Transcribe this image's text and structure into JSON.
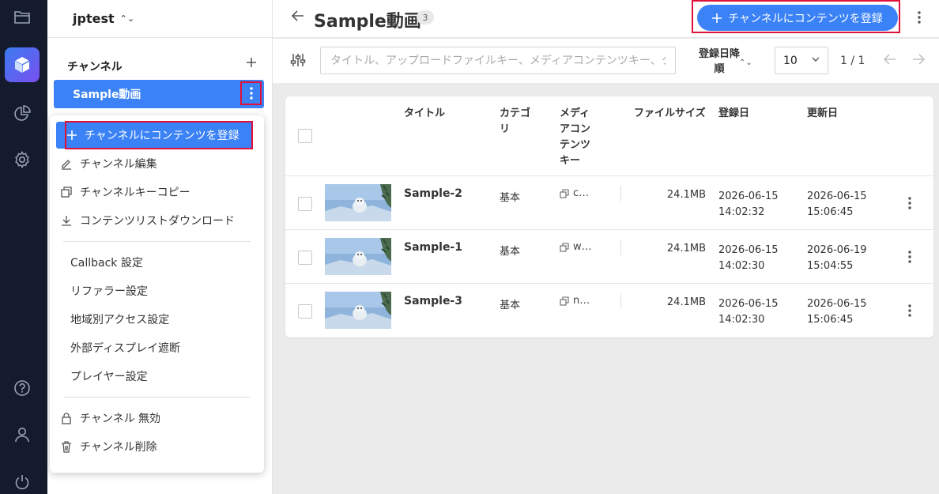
{
  "rail": {
    "items": [
      {
        "icon": "folder-icon"
      },
      {
        "icon": "cube-icon",
        "active": true
      },
      {
        "icon": "pie-chart-icon"
      },
      {
        "icon": "gear-icon"
      },
      {
        "icon": "help-icon"
      },
      {
        "icon": "user-icon"
      },
      {
        "icon": "power-icon"
      }
    ]
  },
  "sidebar": {
    "workspace": "jptest",
    "section_title": "チャンネル",
    "channel": "Sample動画"
  },
  "context_menu": {
    "primary": "チャンネルにコンテンツを登録",
    "items": [
      "チャンネル編集",
      "チャンネルキーコピー",
      "コンテンツリストダウンロード",
      "Callback 設定",
      "リファラー設定",
      "地域別アクセス設定",
      "外部ディスプレイ遮断",
      "プレイヤー設定",
      "チャンネル 無効",
      "チャンネル削除"
    ]
  },
  "header": {
    "title": "Sample動画",
    "count": "3",
    "register_button": "チャンネルにコンテンツを登録"
  },
  "toolbar": {
    "search_placeholder": "タイトル、アップロードファイルキー、メディアコンテンツキー、タ",
    "sort_line1": "登録日降",
    "sort_line2": "順",
    "per_page": "10",
    "pagination": "1 / 1"
  },
  "table": {
    "headers": {
      "title": "タイトル",
      "category_l1": "カテゴ",
      "category_l2": "リ",
      "media_key_l1": "メディ",
      "media_key_l2": "アコン",
      "media_key_l3": "テンツ",
      "media_key_l4": "キー",
      "file_size": "ファイルサイズ",
      "created": "登録日",
      "updated": "更新日"
    },
    "rows": [
      {
        "title": "Sample-2",
        "category": "基本",
        "media_key": "c…",
        "file_size": "24.1MB",
        "created_date": "2026-06-15",
        "created_time": "14:02:32",
        "updated_date": "2026-06-15",
        "updated_time": "15:06:45"
      },
      {
        "title": "Sample-1",
        "category": "基本",
        "media_key": "w…",
        "file_size": "24.1MB",
        "created_date": "2026-06-15",
        "created_time": "14:02:30",
        "updated_date": "2026-06-19",
        "updated_time": "15:04:55"
      },
      {
        "title": "Sample-3",
        "category": "基本",
        "media_key": "n…",
        "file_size": "24.1MB",
        "created_date": "2026-06-15",
        "created_time": "14:02:30",
        "updated_date": "2026-06-15",
        "updated_time": "15:06:45"
      }
    ]
  },
  "colors": {
    "accent": "#3b82f6",
    "rail_bg": "#141b2d",
    "highlight": "#e0103a"
  }
}
